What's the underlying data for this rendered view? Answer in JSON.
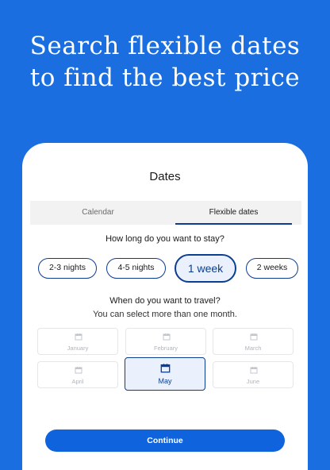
{
  "headline": {
    "line1": "Search flexible dates",
    "line2": "to find the best price"
  },
  "screen": {
    "title": "Dates",
    "tabs": [
      {
        "label": "Calendar",
        "active": false
      },
      {
        "label": "Flexible dates",
        "active": true
      }
    ],
    "stay_question": "How long do you want to stay?",
    "durations": [
      {
        "label": "2-3 nights",
        "selected": false
      },
      {
        "label": "4-5 nights",
        "selected": false
      },
      {
        "label": "1 week",
        "selected": true
      },
      {
        "label": "2 weeks",
        "selected": false
      }
    ],
    "travel_question": "When do you want to travel?",
    "travel_hint": "You can select more than one month.",
    "months": [
      {
        "label": "January",
        "selected": false,
        "icon": "calendar-icon"
      },
      {
        "label": "February",
        "selected": false,
        "icon": "calendar-icon"
      },
      {
        "label": "March",
        "selected": false,
        "icon": "calendar-icon"
      },
      {
        "label": "April",
        "selected": false,
        "icon": "calendar-icon"
      },
      {
        "label": "May",
        "selected": true,
        "icon": "calendar-icon"
      },
      {
        "label": "June",
        "selected": false,
        "icon": "calendar-icon"
      }
    ],
    "continue_label": "Continue"
  },
  "colors": {
    "background": "#1a6ee0",
    "accent": "#0b3e91",
    "button": "#0f63dd",
    "selected_fill": "#eaf1fd"
  }
}
